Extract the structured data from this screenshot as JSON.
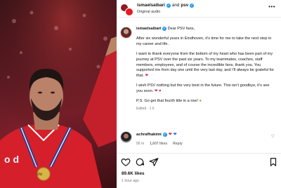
{
  "header": {
    "username": "ismaelsaibari",
    "joiner": "and",
    "coauthor": "psv",
    "audio": "Original audio",
    "more_icon": "more-horizontal-icon"
  },
  "caption": {
    "username": "ismaelsaibari",
    "greeting": "Dear PSV fans,",
    "p1": "After six wonderful years in Eindhoven, it’s time for me to take the next step in my career and life.",
    "p2": "I want to thank everyone from the bottom of my heart who has been part of my journey at PSV over the past six years. To my teammates, coaches, staff members, employees, and of course the incredible fans, thank you. You supported me from day one until the very last day, and I’ll always be grateful for that.",
    "p3": "I wish PSV nothing but the very best in the future. This isn’t goodbye, it’s see you soon.",
    "p4": "P.S. Go get that fourth title in a row!",
    "edited": "Edited · 1 h"
  },
  "comment": {
    "username": "achrafhakimi",
    "time": "56 m",
    "likes": "1,607 likes",
    "reply": "Reply"
  },
  "post": {
    "likes": "89.6K likes",
    "time": "1 hour ago"
  },
  "photo": {
    "medal_text": "Uo",
    "shirt_text": "o d"
  },
  "colors": {
    "psv_red": "#e21b23",
    "verified_blue": "#1d9bf0"
  }
}
